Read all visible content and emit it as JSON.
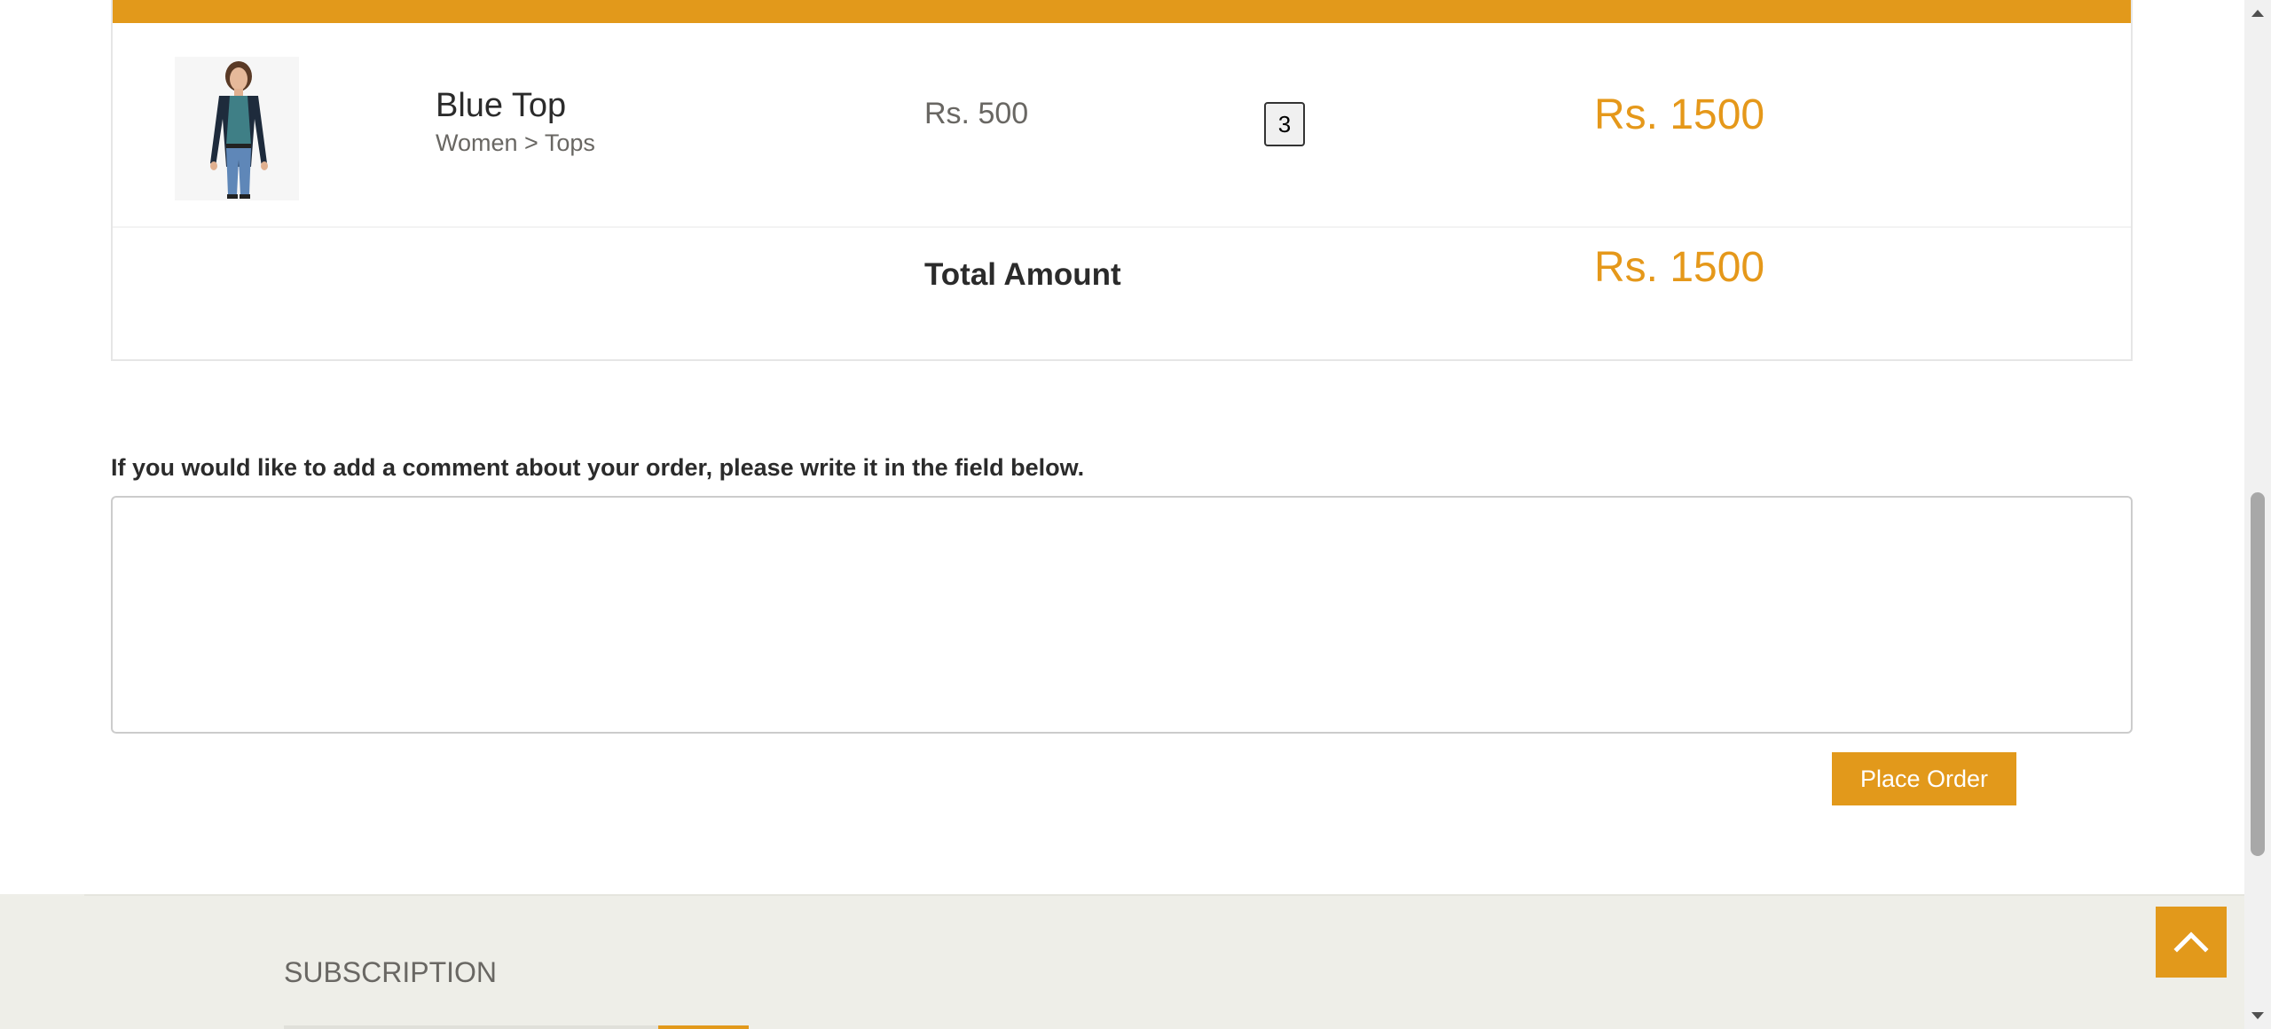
{
  "theme": {
    "accent": "#e5981a",
    "button_bg": "#e2991b"
  },
  "cart": {
    "items": [
      {
        "name": "Blue Top",
        "category": "Women > Tops",
        "price": "Rs. 500",
        "quantity": "3",
        "total": "Rs. 1500",
        "image_icon": "product-photo"
      }
    ],
    "total_label": "Total Amount",
    "total_value": "Rs. 1500"
  },
  "comment": {
    "label": "If you would like to add a comment about your order, please write it in the field below.",
    "value": ""
  },
  "actions": {
    "place_order_label": "Place Order"
  },
  "footer": {
    "subscription_title": "SUBSCRIPTION",
    "scroll_up_icon": "chevron-up-icon"
  }
}
